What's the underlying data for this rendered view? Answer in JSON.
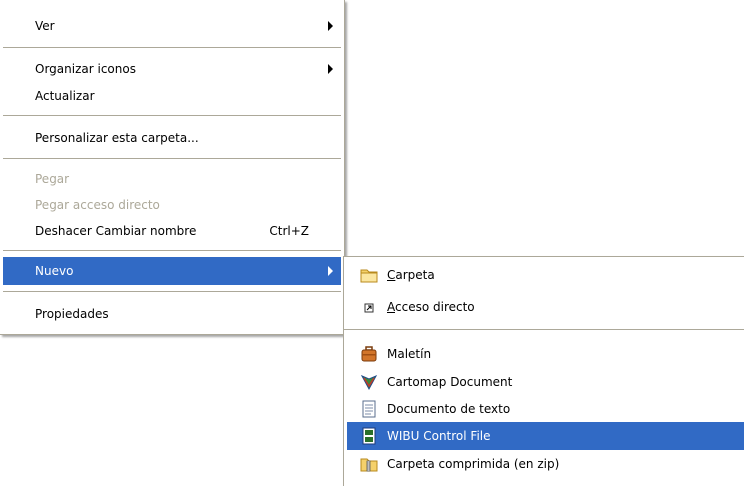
{
  "context_menu": {
    "items": [
      {
        "label": "Ver",
        "has_submenu": true,
        "enabled": true
      },
      {
        "label": "Organizar iconos",
        "has_submenu": true,
        "enabled": true
      },
      {
        "label": "Actualizar",
        "has_submenu": false,
        "enabled": true
      },
      {
        "label": "Personalizar esta carpeta...",
        "has_submenu": false,
        "enabled": true
      },
      {
        "label": "Pegar",
        "has_submenu": false,
        "enabled": false
      },
      {
        "label": "Pegar acceso directo",
        "has_submenu": false,
        "enabled": false
      },
      {
        "label": "Deshacer Cambiar nombre",
        "shortcut": "Ctrl+Z",
        "has_submenu": false,
        "enabled": true
      },
      {
        "label": "Nuevo",
        "has_submenu": true,
        "enabled": true,
        "selected": true
      },
      {
        "label": "Propiedades",
        "has_submenu": false,
        "enabled": true
      }
    ]
  },
  "new_submenu": {
    "items": [
      {
        "mnemonic": "C",
        "rest": "arpeta",
        "icon": "folder-icon"
      },
      {
        "mnemonic": "A",
        "rest": "cceso directo",
        "icon": "shortcut-icon"
      },
      {
        "label": "Maletín",
        "icon": "briefcase-icon"
      },
      {
        "label": "Cartomap Document",
        "icon": "cartomap-icon"
      },
      {
        "label": "Documento de texto",
        "icon": "text-document-icon"
      },
      {
        "label": "WIBU Control File",
        "icon": "wibu-file-icon",
        "selected": true
      },
      {
        "label": "Carpeta comprimida (en zip)",
        "icon": "zip-folder-icon"
      }
    ]
  },
  "colors": {
    "highlight": "#316ac5",
    "highlight_text": "#ffffff",
    "disabled_text": "#aca899",
    "separator": "#aca899",
    "menu_bg": "#ffffff"
  }
}
